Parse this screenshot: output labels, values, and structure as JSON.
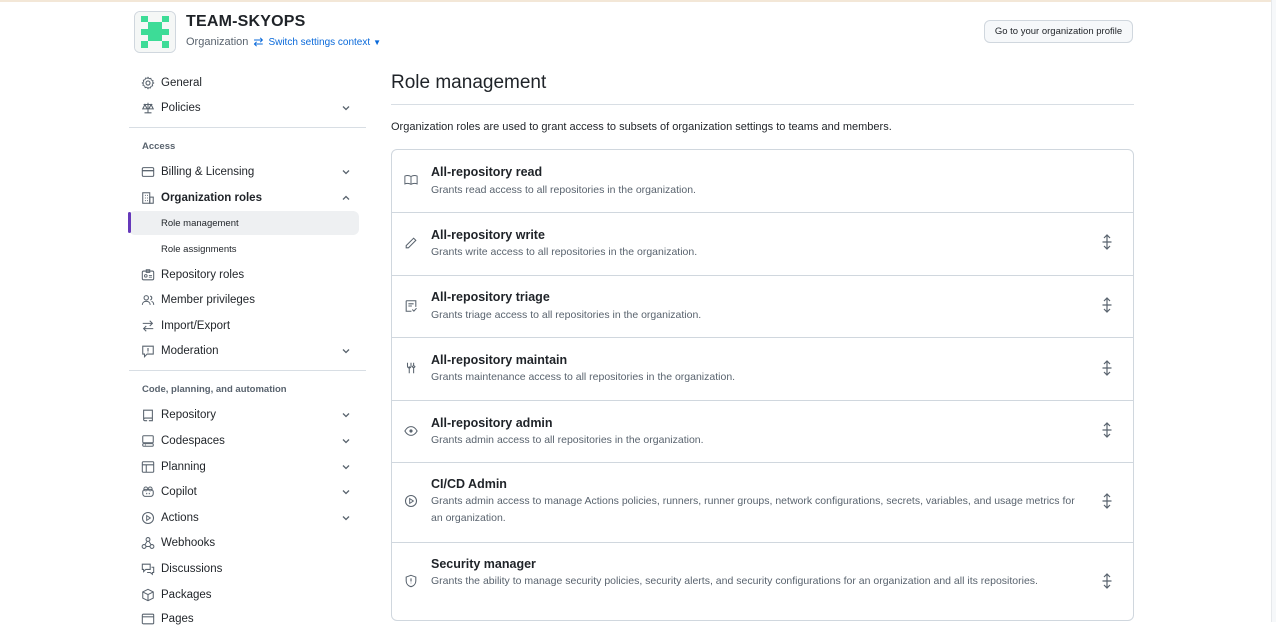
{
  "header": {
    "org_name": "TEAM-SKYOPS",
    "org_type": "Organization",
    "switch_label": "Switch settings context",
    "profile_button": "Go to your organization profile"
  },
  "sidebar": {
    "items_top": [
      {
        "label": "General",
        "icon": "gear-icon"
      },
      {
        "label": "Policies",
        "icon": "law-icon"
      }
    ],
    "access_label": "Access",
    "access_items": [
      {
        "label": "Billing & Licensing",
        "icon": "credit-card-icon"
      },
      {
        "label": "Organization roles",
        "icon": "organization-icon"
      },
      {
        "label": "Role management"
      },
      {
        "label": "Role assignments"
      },
      {
        "label": "Repository roles",
        "icon": "id-badge-icon"
      },
      {
        "label": "Member privileges",
        "icon": "people-icon"
      },
      {
        "label": "Import/Export",
        "icon": "arrow-switch-icon"
      },
      {
        "label": "Moderation",
        "icon": "report-icon"
      }
    ],
    "code_label": "Code, planning, and automation",
    "code_items": [
      {
        "label": "Repository",
        "icon": "repo-icon"
      },
      {
        "label": "Codespaces",
        "icon": "codespaces-icon"
      },
      {
        "label": "Planning",
        "icon": "table-icon"
      },
      {
        "label": "Copilot",
        "icon": "copilot-icon"
      },
      {
        "label": "Actions",
        "icon": "play-icon"
      },
      {
        "label": "Webhooks",
        "icon": "webhook-icon"
      },
      {
        "label": "Discussions",
        "icon": "comment-discussion-icon"
      },
      {
        "label": "Packages",
        "icon": "package-icon"
      },
      {
        "label": "Pages",
        "icon": "browser-icon"
      }
    ]
  },
  "main": {
    "title": "Role management",
    "description": "Organization roles are used to grant access to subsets of organization settings to teams and members.",
    "roles": [
      {
        "title": "All-repository read",
        "description": "Grants read access to all repositories in the organization.",
        "icon": "book-icon"
      },
      {
        "title": "All-repository write",
        "description": "Grants write access to all repositories in the organization.",
        "icon": "pencil-icon"
      },
      {
        "title": "All-repository triage",
        "description": "Grants triage access to all repositories in the organization.",
        "icon": "tasklist-icon"
      },
      {
        "title": "All-repository maintain",
        "description": "Grants maintenance access to all repositories in the organization.",
        "icon": "tools-icon"
      },
      {
        "title": "All-repository admin",
        "description": "Grants admin access to all repositories in the organization.",
        "icon": "eye-icon"
      },
      {
        "title": "CI/CD Admin",
        "description": "Grants admin access to manage Actions policies, runners, runner groups, network configurations, secrets, variables, and usage metrics for an organization.",
        "icon": "play-icon"
      },
      {
        "title": "Security manager",
        "description": "Grants the ability to manage security policies, security alerts, and security configurations for an organization and all its repositories.",
        "icon": "shield-icon"
      }
    ]
  },
  "colors": {
    "accent": "#6639ba",
    "link": "#0969da",
    "avatar": "#3ddc97"
  }
}
